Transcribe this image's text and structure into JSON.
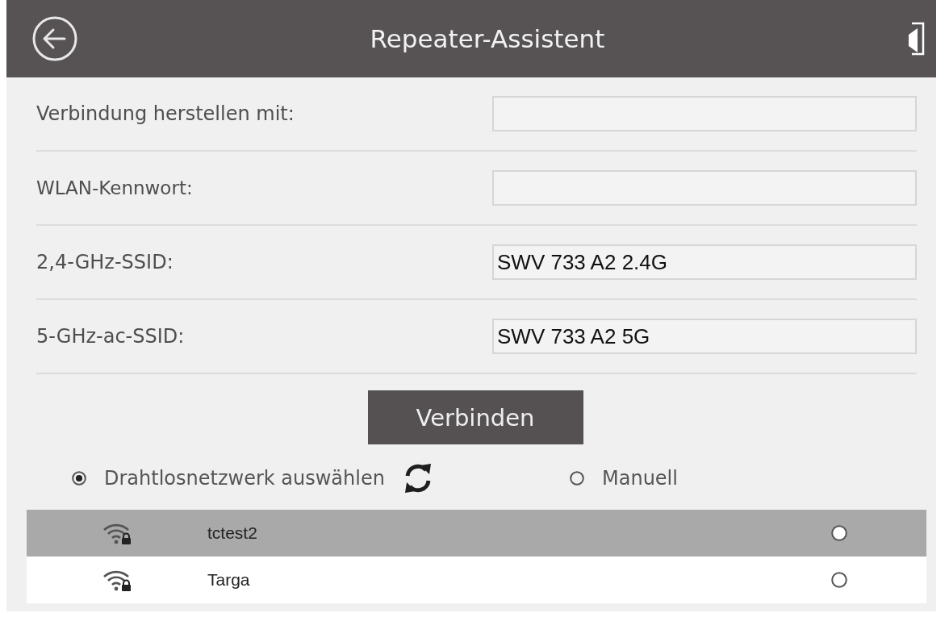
{
  "header": {
    "title": "Repeater-Assistent"
  },
  "form": {
    "fields": [
      {
        "label": "Verbindung herstellen mit:"
      },
      {
        "label": "WLAN-Kennwort:"
      },
      {
        "label": "2,4-GHz-SSID:",
        "value": "SWV 733 A2 2.4G"
      },
      {
        "label": "5-GHz-ac-SSID:",
        "value": "SWV 733 A2 5G"
      }
    ]
  },
  "connect_button": {
    "label": "Verbinden"
  },
  "mode_options": [
    {
      "label": "Drahtlosnetzwerk auswählen",
      "selected": true
    },
    {
      "label": "Manuell",
      "selected": false
    }
  ],
  "networks": [
    {
      "name": "tctest2",
      "highlighted": true,
      "selected": false
    },
    {
      "name": "Targa",
      "highlighted": false,
      "selected": false
    }
  ]
}
